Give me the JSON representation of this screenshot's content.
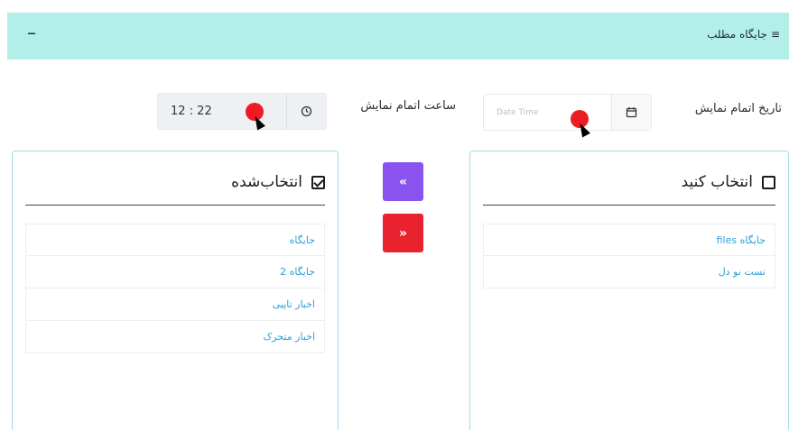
{
  "header": {
    "title": "جایگاه مطلب",
    "collapse_label": "–"
  },
  "form": {
    "date_label": "تاریخ اتمام نمایش",
    "date_placeholder": "Date Time",
    "time_label": "ساعت اتمام نمایش",
    "time_value": "12 : 22"
  },
  "available": {
    "title": "انتخاب کنید",
    "checked": false,
    "items": [
      {
        "label": "جایگاه files"
      },
      {
        "label": "تست نو دل"
      }
    ]
  },
  "selected": {
    "title": "انتخاب‌شده",
    "checked": true,
    "items": [
      {
        "label": "جایگاه"
      },
      {
        "label": "جایگاه 2"
      },
      {
        "label": "اخبار تاپیی"
      },
      {
        "label": "اخبار متحرک"
      }
    ]
  },
  "buttons": {
    "move_left": "«",
    "move_right": "»"
  },
  "colors": {
    "header_bg": "#b3efe9",
    "panel_border": "#9fdbe5",
    "link": "#2f9fd6",
    "purple_button": "#8a53f0",
    "red_button": "#e8232f",
    "cursor_marker": "#ee1b24"
  },
  "icons": {
    "header": "layers-icon",
    "date": "calendar-icon",
    "time": "clock-icon"
  }
}
